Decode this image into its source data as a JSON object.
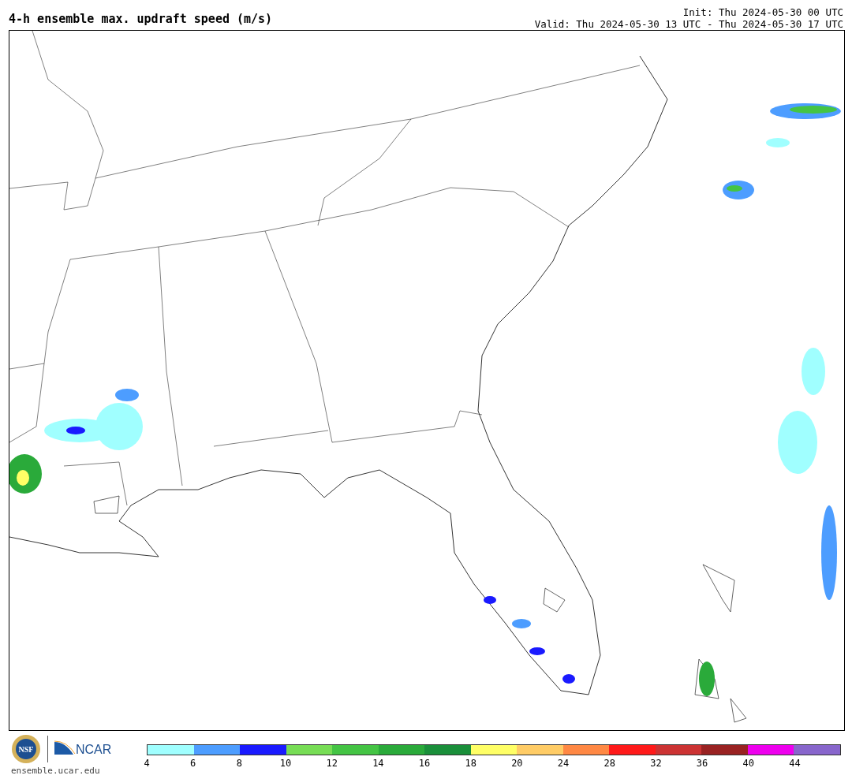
{
  "title": "4-h ensemble max. updraft speed (m/s)",
  "init": "Init: Thu 2024-05-30 00 UTC",
  "valid": "Valid: Thu 2024-05-30 13 UTC - Thu 2024-05-30 17 UTC",
  "logos": {
    "seal_text": "NSF",
    "brand_text": "NCAR",
    "url": "ensemble.ucar.edu"
  },
  "colorbar": [
    {
      "label": "4",
      "color": "#a0ffff"
    },
    {
      "label": "6",
      "color": "#4d9dff"
    },
    {
      "label": "8",
      "color": "#1a1aff"
    },
    {
      "label": "10",
      "color": "#77dd55"
    },
    {
      "label": "12",
      "color": "#44c444"
    },
    {
      "label": "14",
      "color": "#2aaa3a"
    },
    {
      "label": "16",
      "color": "#1a8f3a"
    },
    {
      "label": "18",
      "color": "#ffff66"
    },
    {
      "label": "20",
      "color": "#ffcc66"
    },
    {
      "label": "24",
      "color": "#ff8844"
    },
    {
      "label": "28",
      "color": "#ff1a1a"
    },
    {
      "label": "32",
      "color": "#cc3333"
    },
    {
      "label": "36",
      "color": "#992222"
    },
    {
      "label": "40",
      "color": "#ee00ee"
    },
    {
      "label": "44",
      "color": "#8866cc"
    }
  ]
}
